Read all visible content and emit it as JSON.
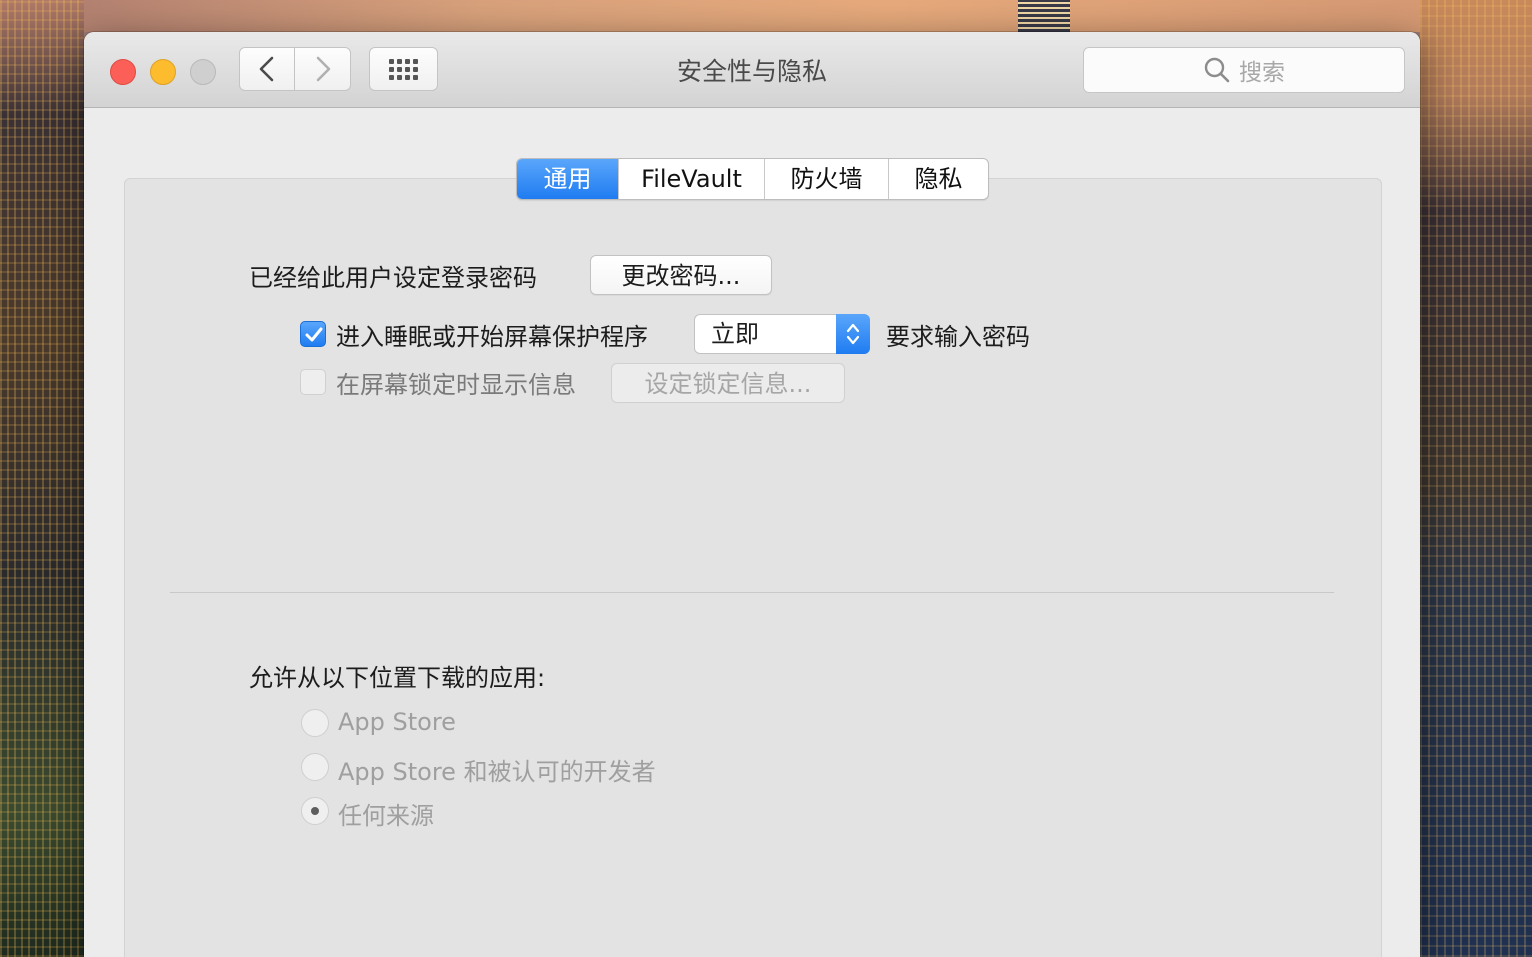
{
  "window": {
    "title": "安全性与隐私",
    "search_placeholder": "搜索"
  },
  "tabs": [
    {
      "label": "通用",
      "active": true
    },
    {
      "label": "FileVault",
      "active": false
    },
    {
      "label": "防火墙",
      "active": false
    },
    {
      "label": "隐私",
      "active": false
    }
  ],
  "general": {
    "password_label": "已经给此用户设定登录密码",
    "change_password_button": "更改密码...",
    "require_password": {
      "checked": true,
      "label": "进入睡眠或开始屏幕保护程序",
      "delay_value": "立即",
      "suffix": "要求输入密码"
    },
    "lock_message": {
      "checked": false,
      "enabled": false,
      "label": "在屏幕锁定时显示信息",
      "button": "设定锁定信息..."
    }
  },
  "downloads": {
    "label": "允许从以下位置下载的应用:",
    "options": [
      {
        "label": "App Store",
        "selected": false
      },
      {
        "label": "App Store 和被认可的开发者",
        "selected": false
      },
      {
        "label": "任何来源",
        "selected": true
      }
    ],
    "enabled": false
  },
  "colors": {
    "accent": "#1f7cf1",
    "close": "#fc5f57",
    "minimize": "#fdbc2e",
    "maximize_disabled": "#cfcfcf"
  },
  "icons": [
    "chevron-left-icon",
    "chevron-right-icon",
    "grid-icon",
    "search-icon",
    "checkmark-icon",
    "updown-arrows-icon"
  ]
}
